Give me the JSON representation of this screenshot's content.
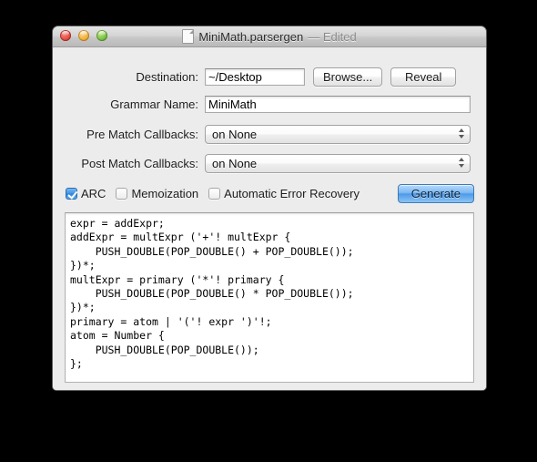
{
  "window": {
    "title_document": "MiniMath.parsergen",
    "title_status": "— Edited",
    "doc_icon": "document-icon",
    "controls": {
      "close": "close-button",
      "minimize": "minimize-button",
      "zoom": "zoom-button"
    }
  },
  "form": {
    "destination": {
      "label": "Destination:",
      "value": "~/Desktop",
      "placeholder": "",
      "browse_label": "Browse...",
      "reveal_label": "Reveal"
    },
    "grammar_name": {
      "label": "Grammar Name:",
      "value": "MiniMath",
      "placeholder": ""
    },
    "pre_match": {
      "label": "Pre Match Callbacks:",
      "value": "on None"
    },
    "post_match": {
      "label": "Post Match Callbacks:",
      "value": "on None"
    }
  },
  "options": {
    "arc": {
      "label": "ARC",
      "checked": true
    },
    "memoization": {
      "label": "Memoization",
      "checked": false
    },
    "auto_error_recovery": {
      "label": "Automatic Error Recovery",
      "checked": false
    },
    "generate_label": "Generate"
  },
  "editor": {
    "grammar_source": "expr = addExpr;\naddExpr = multExpr ('+'! multExpr {\n    PUSH_DOUBLE(POP_DOUBLE() + POP_DOUBLE());\n})*;\nmultExpr = primary ('*'! primary {\n    PUSH_DOUBLE(POP_DOUBLE() * POP_DOUBLE());\n})*;\nprimary = atom | '('! expr ')'!;\natom = Number {\n    PUSH_DOUBLE(POP_DOUBLE());\n};"
  },
  "colors": {
    "accent_blue": "#4e9ae9",
    "checkbox_on": "#2b82da",
    "window_bg": "#ececec",
    "editor_bg": "#ffffff",
    "desktop_bg": "#000000"
  }
}
